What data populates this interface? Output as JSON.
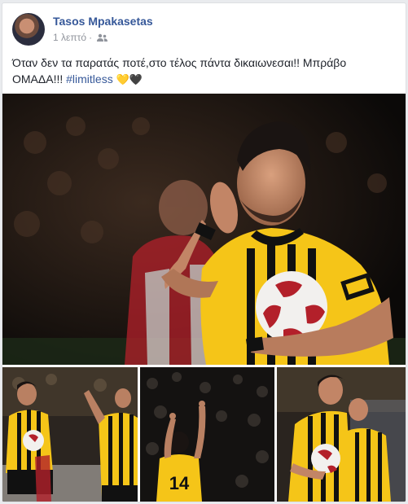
{
  "post": {
    "author": "Tasos Mpakasetas",
    "time": "1 λεπτό",
    "privacy_icon": "friends-icon",
    "text_main": "Όταν δεν τα παρατάς ποτέ,στο τέλος πάντα δικαιωνεσαι!! Μπράβο ΟΜΑΔΑ!!!",
    "hashtag": "#limitless",
    "emoji_1": "💛",
    "emoji_2": "🖤",
    "jersey_number": "14"
  },
  "colors": {
    "link": "#365899",
    "aek_yellow": "#f5c518",
    "aek_black": "#111111",
    "olympiacos_red": "#b3202a"
  }
}
